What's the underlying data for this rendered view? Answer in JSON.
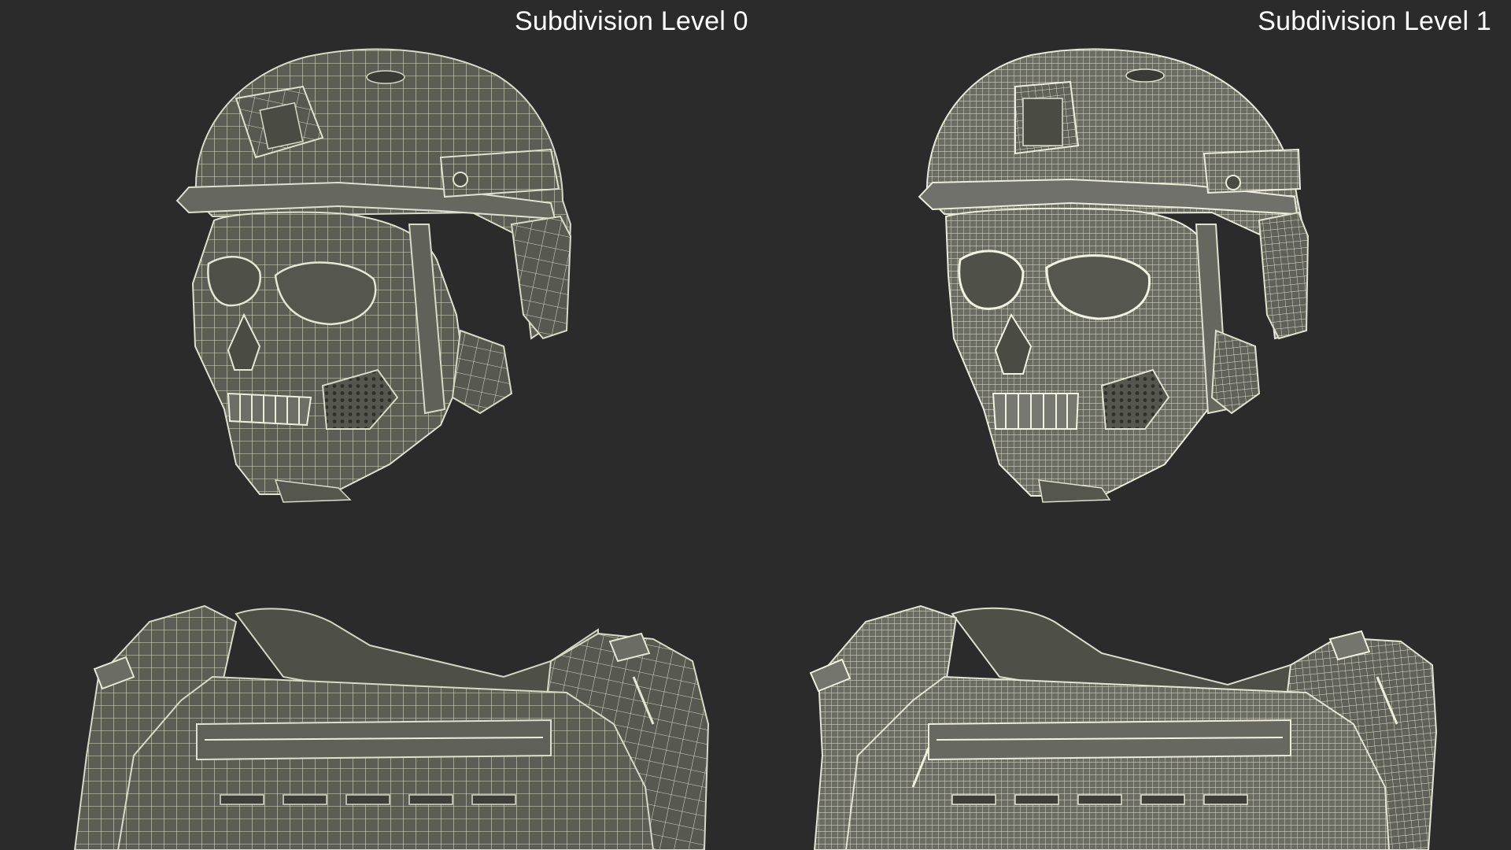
{
  "labels": {
    "left": "Subdivision Level 0",
    "right": "Subdivision Level 1"
  },
  "colors": {
    "background": "#2b2b2b",
    "surface": "#5c5e55",
    "wire": "#e6e6d6",
    "label": "#ffffff"
  },
  "objects": [
    {
      "name": "helmet-with-skull-mask",
      "variant": "subdivision-level-0"
    },
    {
      "name": "helmet-with-skull-mask",
      "variant": "subdivision-level-1"
    },
    {
      "name": "plate-carrier-vest",
      "variant": "subdivision-level-0"
    },
    {
      "name": "plate-carrier-vest",
      "variant": "subdivision-level-1"
    }
  ]
}
